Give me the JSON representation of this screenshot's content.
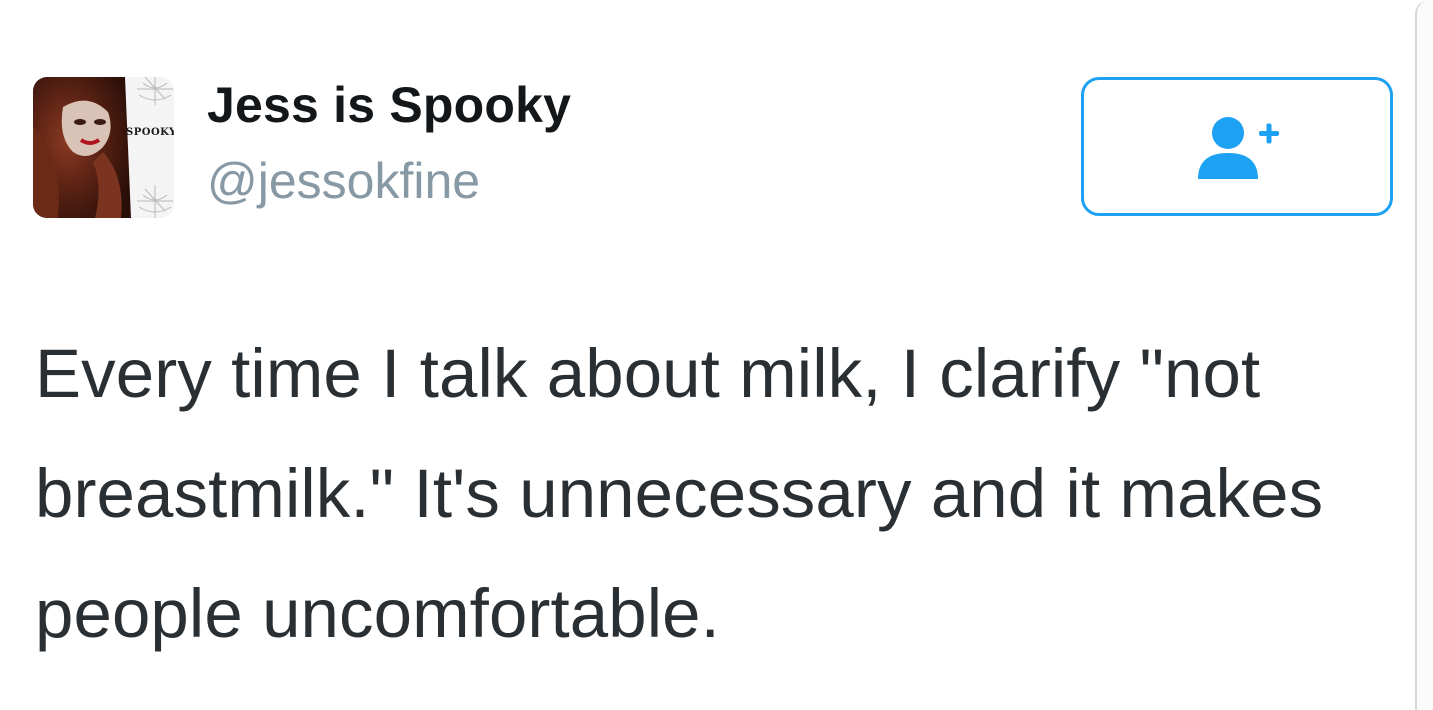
{
  "user": {
    "display_name": "Jess is Spooky",
    "handle": "@jessokfine",
    "avatar_label": "SPOOKY"
  },
  "follow_button": {
    "icon": "add-user-icon"
  },
  "tweet": {
    "text": "Every time I talk about milk, I clarify \"not breastmilk.\" It's unnecessary and it makes people uncomfortable."
  },
  "colors": {
    "accent": "#1da1f2",
    "handle": "#8899a6",
    "text": "#292f33"
  }
}
